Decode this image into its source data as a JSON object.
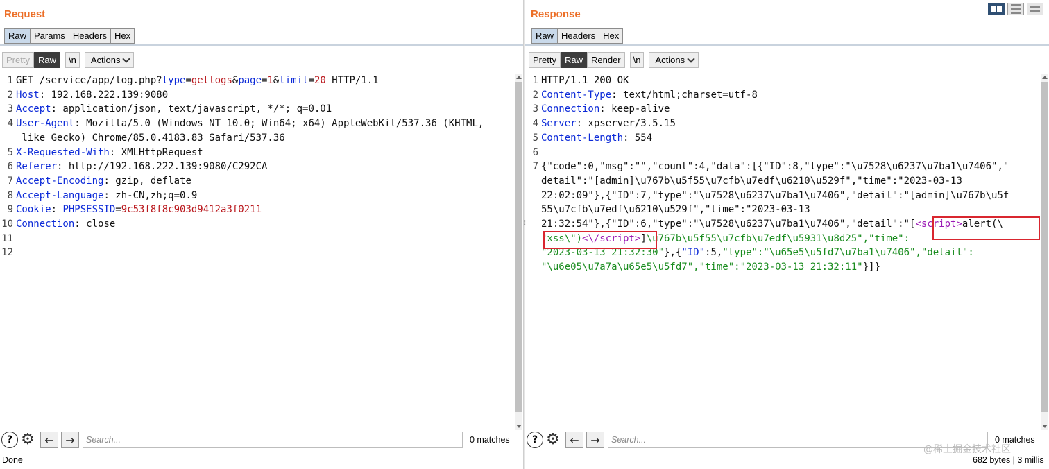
{
  "request": {
    "title": "Request",
    "tabs": [
      "Raw",
      "Params",
      "Headers",
      "Hex"
    ],
    "toolbar": {
      "pretty": "Pretty",
      "raw": "Raw",
      "newline": "\\n",
      "actions": "Actions"
    },
    "search_placeholder": "Search...",
    "matches": "0 matches",
    "status": "Done"
  },
  "response": {
    "title": "Response",
    "tabs": [
      "Raw",
      "Headers",
      "Hex"
    ],
    "toolbar": {
      "pretty": "Pretty",
      "raw": "Raw",
      "render": "Render",
      "newline": "\\n",
      "actions": "Actions"
    },
    "search_placeholder": "Search...",
    "matches": "0 matches",
    "status": "682 bytes | 3 millis"
  },
  "watermark": "@稀土掘金技术社区",
  "colors": {
    "title": "#ec6f28",
    "header_name": "#0c2ad8",
    "param_value": "#b9161b",
    "json_string": "#1a8c1f",
    "highlight": "#d9262f"
  },
  "icons": [
    "help-icon",
    "gear-icon",
    "back-arrow-icon",
    "forward-arrow-icon",
    "chevron-down-icon"
  ]
}
